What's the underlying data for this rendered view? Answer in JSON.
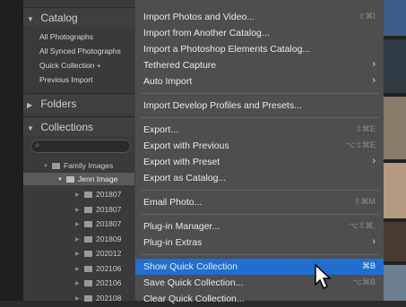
{
  "sidebar": {
    "catalog_title": "Catalog",
    "catalog_items": [
      "All Photographs",
      "All Synced Photographs",
      "Quick Collection +",
      "Previous Import"
    ],
    "folders_title": "Folders",
    "collections_title": "Collections",
    "tree_parent": "Family Images",
    "tree_selected": "Jenn Image",
    "tree_children": [
      "201807",
      "201807",
      "201807",
      "201809",
      "202012",
      "202106",
      "202106",
      "202108"
    ]
  },
  "menu": {
    "items": [
      {
        "label": "Import Photos and Video...",
        "shortcut": "⇧⌘I"
      },
      {
        "label": "Import from Another Catalog..."
      },
      {
        "label": "Import a Photoshop Elements Catalog..."
      },
      {
        "label": "Tethered Capture",
        "arrow": "›"
      },
      {
        "label": "Auto Import",
        "arrow": "›"
      },
      {
        "label": "Import Develop Profiles and Presets..."
      },
      {
        "label": "Export...",
        "shortcut": "⇧⌘E"
      },
      {
        "label": "Export with Previous",
        "shortcut": "⌥⇧⌘E"
      },
      {
        "label": "Export with Preset",
        "arrow": "›"
      },
      {
        "label": "Export as Catalog..."
      },
      {
        "label": "Email Photo...",
        "shortcut": "⇧⌘M"
      },
      {
        "label": "Plug-in Manager...",
        "shortcut": "⌥⇧⌘,"
      },
      {
        "label": "Plug-in Extras",
        "arrow": "›"
      },
      {
        "label": "Show Quick Collection",
        "shortcut": "⌘B"
      },
      {
        "label": "Save Quick Collection...",
        "shortcut": "⌥⌘B"
      },
      {
        "label": "Clear Quick Collection..."
      }
    ]
  },
  "colors": {
    "highlight": "#1f6fd0",
    "menu_bg": "#4e4e4e",
    "panel_bg": "#3a3a3a"
  }
}
